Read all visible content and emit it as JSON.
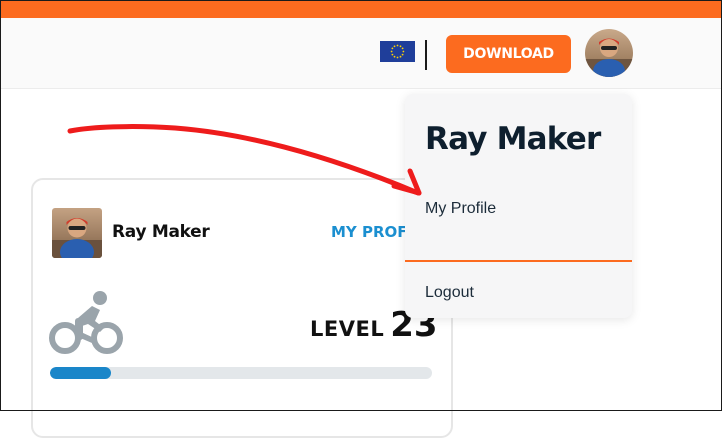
{
  "colors": {
    "brand_orange": "#fc6b1f",
    "link_blue": "#1b8fd0",
    "progress_blue": "#1a86c9",
    "annotation_red": "#ee1c1c"
  },
  "header": {
    "region_flag": "eu-flag-icon",
    "download_label": "DOWNLOAD",
    "avatar": "user-avatar"
  },
  "dropdown": {
    "user_name": "Ray Maker",
    "my_profile_label": "My Profile",
    "logout_label": "Logout"
  },
  "card": {
    "user_name": "Ray Maker",
    "my_profile_link": "MY PROF",
    "sport_icon": "cycling-icon",
    "level_label": "LEVEL",
    "level_value": "23",
    "level_progress": 0.16
  },
  "annotation": {
    "type": "hand-drawn red arrow pointing to My Profile"
  }
}
